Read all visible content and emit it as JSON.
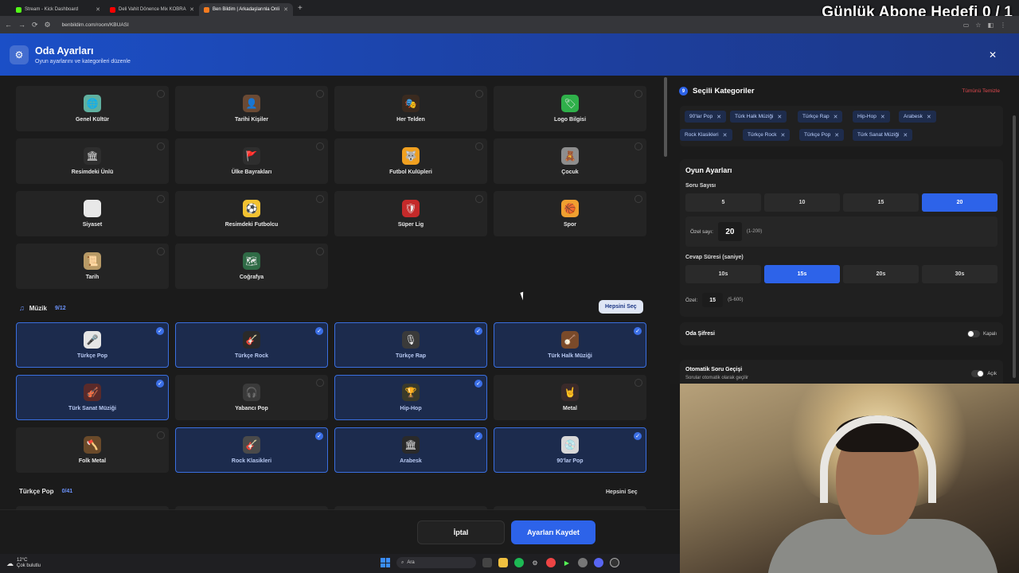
{
  "browser": {
    "tabs": [
      {
        "label": "Stream - Kick Dashboard",
        "color": "#53fc18"
      },
      {
        "label": "Deli Vahit Dönence Mix KOBRA",
        "color": "#ff0000"
      },
      {
        "label": "Ben Bildim | Arkadaşlarınla Onli",
        "color": "#f47b20"
      }
    ],
    "url": "benbildim.com/room/KBUASI"
  },
  "overlay_title": "Günlük Abone Hedefi 0 / 1",
  "header": {
    "title": "Oda Ayarları",
    "subtitle": "Oyun ayarlarını ve kategorileri düzenle",
    "close": "✕",
    "settings_icon": "⚙"
  },
  "general_cards": [
    {
      "label": "Genel Kültür",
      "icon": "🌐",
      "bg": "#5fb0a0"
    },
    {
      "label": "Tarihi Kişiler",
      "icon": "👤",
      "bg": "#6b4a34"
    },
    {
      "label": "Her Telden",
      "icon": "🎭",
      "bg": "#3a2a1f"
    },
    {
      "label": "Logo Bilgisi",
      "icon": "🏷",
      "bg": "#2fb04a"
    },
    {
      "label": "Resimdeki Ünlü",
      "icon": "🏛",
      "bg": "#2e2e2e"
    },
    {
      "label": "Ülke Bayrakları",
      "icon": "🚩",
      "bg": "#2e2e2e"
    },
    {
      "label": "Futbol Kulüpleri",
      "icon": "🐺",
      "bg": "#f0a020"
    },
    {
      "label": "Çocuk",
      "icon": "🧸",
      "bg": "#8e8e8e"
    },
    {
      "label": "Siyaset",
      "icon": "🗳",
      "bg": "#e8e8e8"
    },
    {
      "label": "Resimdeki Futbolcu",
      "icon": "⚽",
      "bg": "#f2c231"
    },
    {
      "label": "Süper Lig",
      "icon": "🛡",
      "bg": "#c42a2a"
    },
    {
      "label": "Spor",
      "icon": "🏀",
      "bg": "#f0a030"
    },
    {
      "label": "Tarih",
      "icon": "📜",
      "bg": "#b89a66"
    },
    {
      "label": "Coğrafya",
      "icon": "🗺",
      "bg": "#2f6b46"
    }
  ],
  "music_section": {
    "title": "Müzik",
    "count": "9/12",
    "select_all": "Hepsini Seç",
    "cards": [
      {
        "label": "Türkçe Pop",
        "icon": "🎤",
        "bg": "#e6e6e6",
        "selected": true
      },
      {
        "label": "Türkçe Rock",
        "icon": "🎸",
        "bg": "#2a2a2a",
        "selected": true
      },
      {
        "label": "Türkçe Rap",
        "icon": "🎙",
        "bg": "#3a3a3a",
        "selected": true
      },
      {
        "label": "Türk Halk Müziği",
        "icon": "🪕",
        "bg": "#7a4a2a",
        "selected": true
      },
      {
        "label": "Türk Sanat Müziği",
        "icon": "🎻",
        "bg": "#5a2a2a",
        "selected": true
      },
      {
        "label": "Yabancı Pop",
        "icon": "🎧",
        "bg": "#3a3a3a",
        "selected": false
      },
      {
        "label": "Hip-Hop",
        "icon": "🏆",
        "bg": "#3a3a2a",
        "selected": true
      },
      {
        "label": "Metal",
        "icon": "🤘",
        "bg": "#3a2a2a",
        "selected": false
      },
      {
        "label": "Folk Metal",
        "icon": "🪓",
        "bg": "#6a4a2a",
        "selected": false
      },
      {
        "label": "Rock Klasikleri",
        "icon": "🎸",
        "bg": "#4a4a4a",
        "selected": true
      },
      {
        "label": "Arabesk",
        "icon": "🏛",
        "bg": "#2a2a2a",
        "selected": true
      },
      {
        "label": "90'lar Pop",
        "icon": "💿",
        "bg": "#d8d8d8",
        "selected": true
      }
    ]
  },
  "turkce_pop_section": {
    "title": "Türkçe Pop",
    "count": "0/41",
    "select_all": "Hepsini Seç"
  },
  "footer": {
    "cancel": "İptal",
    "save": "Ayarları Kaydet"
  },
  "right": {
    "selected_title": "Seçili Kategoriler",
    "selected_count": "9",
    "clear_all": "Tümünü Temizle",
    "chips": [
      "90'lar Pop",
      "Türk Halk Müziği",
      "Türkçe Rap",
      "Hip-Hop",
      "Arabesk",
      "Rock Klasikleri",
      "Türkçe Rock",
      "Türkçe Pop",
      "Türk Sanat Müziği"
    ],
    "game_settings": {
      "title": "Oyun Ayarları",
      "question_count_label": "Soru Sayısı",
      "question_options": [
        "5",
        "10",
        "15",
        "20"
      ],
      "question_selected": "20",
      "custom_count_label": "Özel sayı:",
      "custom_count_value": "20",
      "custom_count_range": "(1-200)",
      "answer_time_label": "Cevap Süresi (saniye)",
      "time_options": [
        "10s",
        "15s",
        "20s",
        "30s"
      ],
      "time_selected": "15s",
      "custom_time_label": "Özel:",
      "custom_time_value": "15",
      "custom_time_range": "(5-600)"
    },
    "room_password": {
      "label": "Oda Şifresi",
      "state": "Kapalı"
    },
    "auto_next": {
      "label": "Otomatik Soru Geçişi",
      "sub": "Sorular otomatik olarak geçilir",
      "state": "Açık"
    }
  },
  "taskbar": {
    "temp": "12°C",
    "weather": "Çok bulutlu",
    "search": "Ara"
  }
}
